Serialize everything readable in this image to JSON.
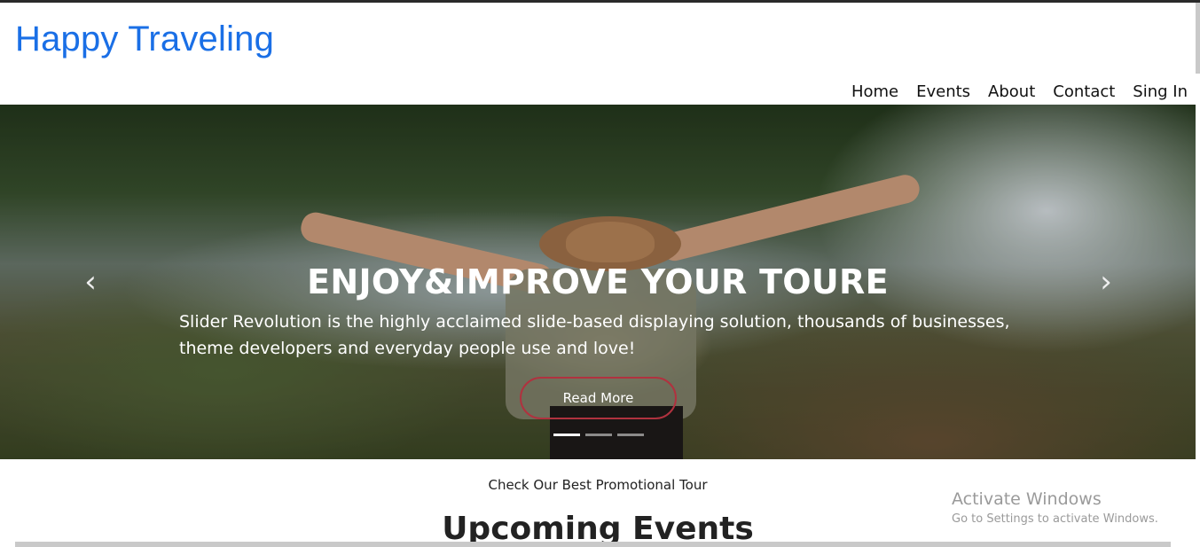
{
  "site": {
    "brand": "Happy Traveling"
  },
  "nav": {
    "items": [
      "Home",
      "Events",
      "About",
      "Contact",
      "Sing In"
    ]
  },
  "hero": {
    "title": "ENJOY&IMPROVE YOUR TOURE",
    "text": "Slider Revolution is the highly acclaimed slide-based displaying solution, thousands of businesses, theme developers and everyday people use and love!",
    "button_label": "Read More",
    "prev_icon": "chevron-left-icon",
    "next_icon": "chevron-right-icon",
    "slides_count": 3,
    "active_slide": 1
  },
  "section": {
    "subtitle": "Check Our Best Promotional Tour",
    "heading": "Upcoming Events"
  },
  "watermark": {
    "title": "Activate Windows",
    "subtitle": "Go to Settings to activate Windows."
  },
  "colors": {
    "brand": "#1a6fe6",
    "button_border": "#b0323f"
  }
}
